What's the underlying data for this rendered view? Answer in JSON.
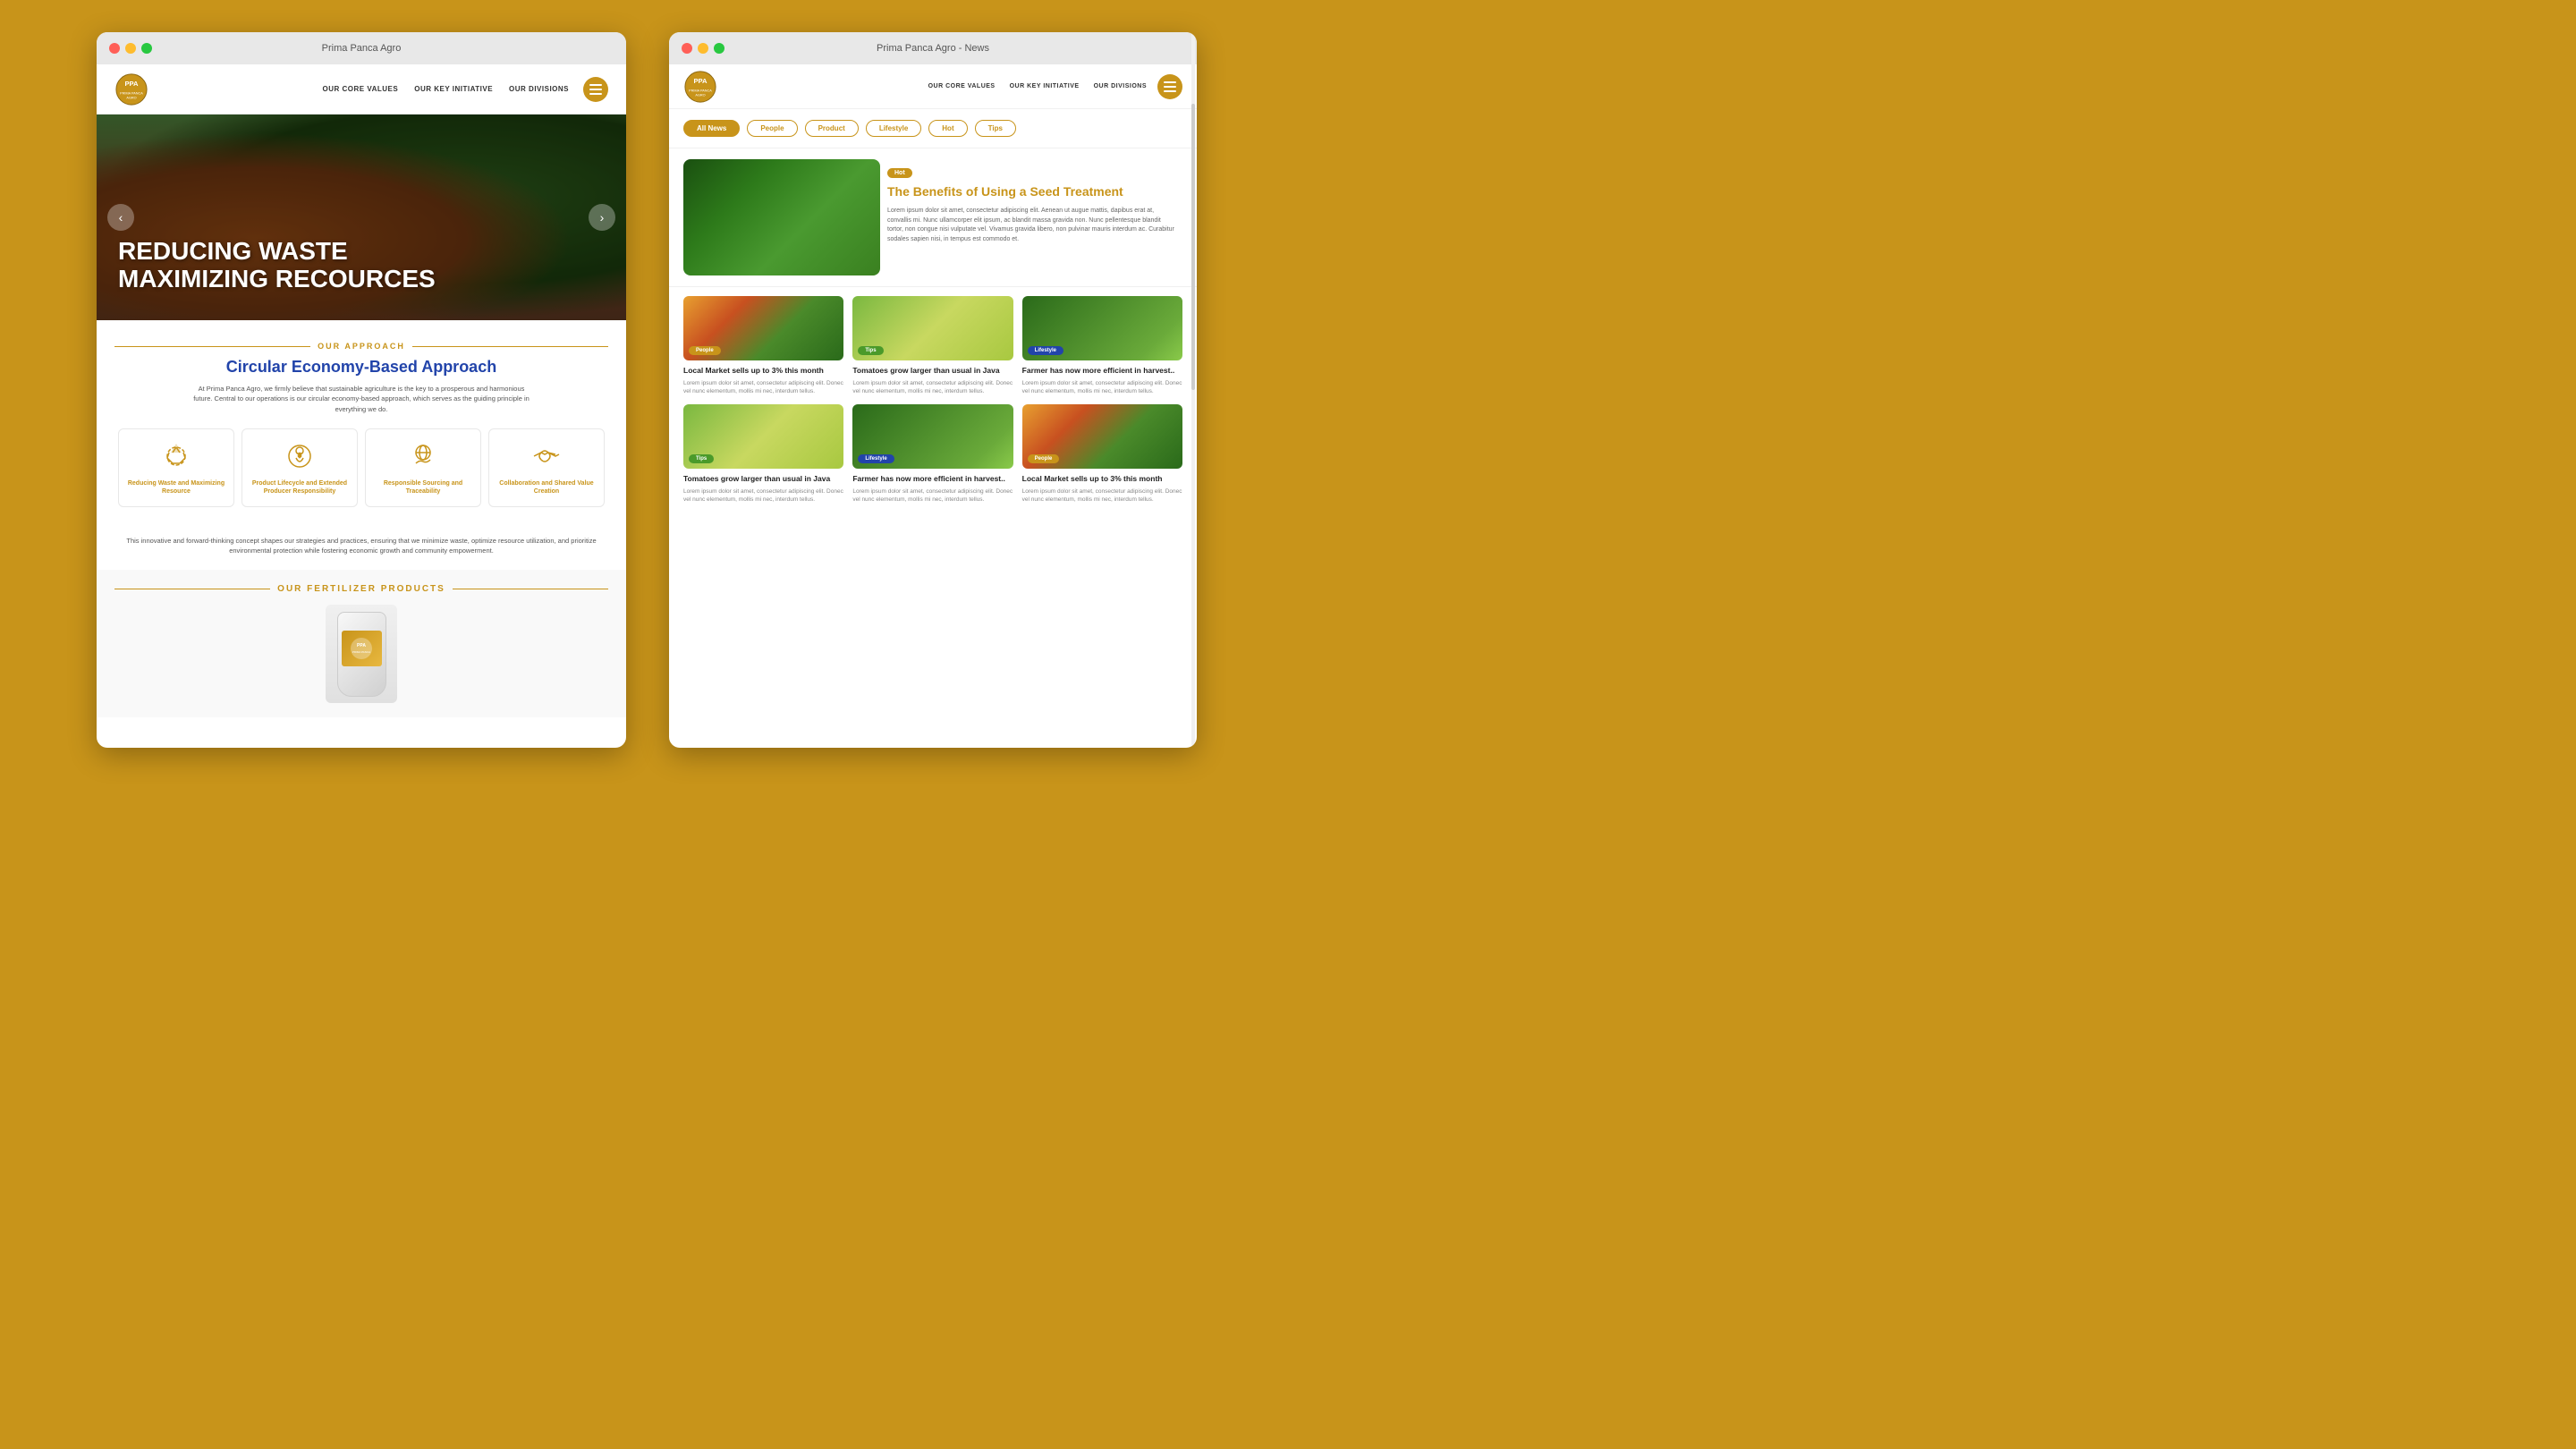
{
  "background_color": "#C8941A",
  "left_window": {
    "title": "Prima Panca Agro",
    "navbar": {
      "logo_text": "PPA",
      "logo_subtitle": "PRIMA PANCA AGRO",
      "links": [
        "OUR CORE VALUES",
        "OUR KEY INITIATIVE",
        "OUR DIVISIONS"
      ]
    },
    "hero": {
      "title_line1": "REDUCING WASTE",
      "title_line2": "MAXIMIZING RECOURCES",
      "arrow_left": "‹",
      "arrow_right": "›"
    },
    "approach": {
      "section_label": "OUR APPROACH",
      "title": "Circular Economy-Based Approach",
      "description": "At Prima Panca Agro, we firmly believe that sustainable agriculture is the key to a prosperous and harmonious future. Central to our operations is our circular economy-based approach, which serves as the guiding principle in everything we do.",
      "cards": [
        {
          "icon": "recycle",
          "label": "Reducing Waste and Maximizing Resource"
        },
        {
          "icon": "lifecycle",
          "label": "Product Lifecycle and Extended Producer Responsibility"
        },
        {
          "icon": "globe-hands",
          "label": "Responsible Sourcing and Traceability"
        },
        {
          "icon": "handshake",
          "label": "Collaboration and Shared Value Creation"
        }
      ],
      "footer_text": "This innovative and forward-thinking concept shapes our strategies and practices, ensuring that we minimize waste, optimize resource utilization, and prioritize environmental protection while fostering economic growth and community empowerment."
    },
    "fertilizer": {
      "section_label": "OUR FERTILIZER PRODUCTS"
    }
  },
  "right_window": {
    "title": "Prima Panca Agro - News",
    "navbar": {
      "logo_text": "PPA",
      "links": [
        "OUR CORE VALUES",
        "OUR KEY INITIATIVE",
        "OUR DIVISIONS"
      ]
    },
    "filter_tabs": [
      {
        "label": "All News",
        "active": true
      },
      {
        "label": "People",
        "active": false
      },
      {
        "label": "Product",
        "active": false
      },
      {
        "label": "Lifestyle",
        "active": false
      },
      {
        "label": "Hot",
        "active": false
      },
      {
        "label": "Tips",
        "active": false
      }
    ],
    "featured": {
      "badge": "Hot",
      "title": "The Benefits of Using a Seed Treatment",
      "description": "Lorem ipsum dolor sit amet, consectetur adipiscing elit. Aenean ut augue mattis, dapibus erat at, convallis mi. Nunc ullamcorper elit ipsum, ac blandit massa gravida non. Nunc pellentesque blandit tortor, non congue nisi vulputate vel. Vivamus gravida libero, non pulvinar mauris interdum ac. Curabitur sodales sapien nisi, in tempus est commodo et."
    },
    "news_row1": [
      {
        "badge": "People",
        "badge_class": "badge-people",
        "title": "Local Market sells up to 3% this month",
        "description": "Lorem ipsum dolor sit amet, consectetur adipiscing elit. Donec vel nunc elementum, mollis mi nec, interdum tellus.",
        "img_class": "img-veggies"
      },
      {
        "badge": "Tips",
        "badge_class": "badge-tips",
        "title": "Tomatoes grow larger than usual in Java",
        "description": "Lorem ipsum dolor sit amet, consectetur adipiscing elit. Donec vel nunc elementum, mollis mi nec, interdum tellus.",
        "img_class": "img-farm-lady"
      },
      {
        "badge": "Lifestyle",
        "badge_class": "badge-lifestyle",
        "title": "Farmer has now more efficient in harvest..",
        "description": "Lorem ipsum dolor sit amet, consectetur adipiscing elit. Donec vel nunc elementum, mollis mi nec, interdum tellus.",
        "img_class": "img-garden"
      }
    ],
    "news_row2": [
      {
        "badge": "Tips",
        "badge_class": "badge-tips",
        "title": "Tomatoes grow larger than usual in Java",
        "description": "Lorem ipsum dolor sit amet, consectetur adipiscing elit. Donec vel nunc elementum, mollis mi nec, interdum tellus.",
        "img_class": "img-farm-lady"
      },
      {
        "badge": "Lifestyle",
        "badge_class": "badge-lifestyle",
        "title": "Farmer has now more efficient in harvest..",
        "description": "Lorem ipsum dolor sit amet, consectetur adipiscing elit. Donec vel nunc elementum, mollis mi nec, interdum tellus.",
        "img_class": "img-garden"
      },
      {
        "badge": "People",
        "badge_class": "badge-people",
        "title": "Local Market sells up to 3% this month",
        "description": "Lorem ipsum dolor sit amet, consectetur adipiscing elit. Donec vel nunc elementum, mollis mi nec, interdum tellus.",
        "img_class": "img-veggies"
      }
    ]
  }
}
